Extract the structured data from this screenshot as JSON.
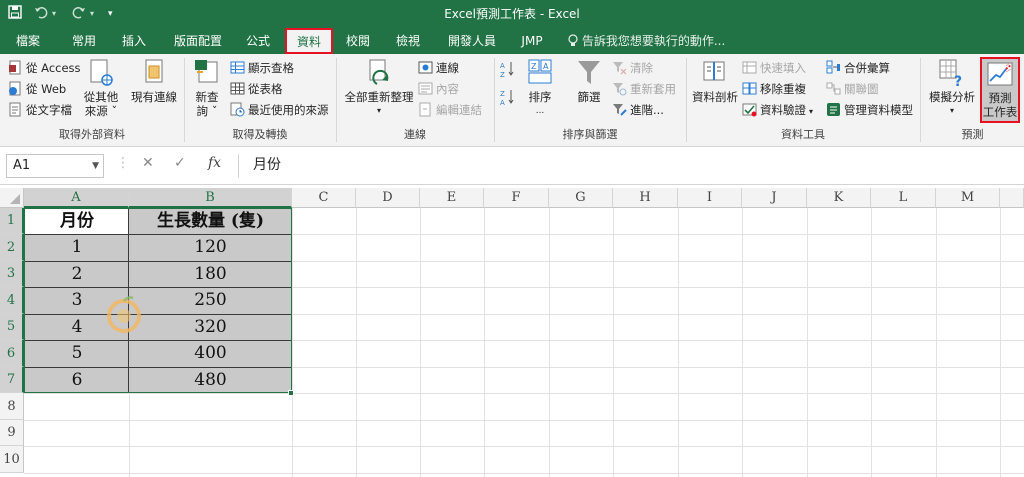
{
  "window": {
    "title": "Excel預測工作表 - Excel"
  },
  "quick_access": {
    "save_icon": "save-icon",
    "undo_icon": "undo-icon",
    "redo_icon": "redo-icon",
    "customize_icon": "customize-icon"
  },
  "tabs": [
    {
      "label": "檔案"
    },
    {
      "label": "常用"
    },
    {
      "label": "插入"
    },
    {
      "label": "版面配置"
    },
    {
      "label": "公式"
    },
    {
      "label": "資料"
    },
    {
      "label": "校閱"
    },
    {
      "label": "檢視"
    },
    {
      "label": "開發人員"
    },
    {
      "label": "JMP"
    }
  ],
  "tell_me": "告訴我您想要執行的動作...",
  "ribbon": {
    "external": {
      "access": "從 Access",
      "web": "從 Web",
      "text": "從文字檔",
      "other_line1": "從其他",
      "other_line2": "來源 ˇ",
      "existing": "現有連線",
      "label": "取得外部資料"
    },
    "transform": {
      "newquery_line1": "新查",
      "newquery_line2": "詢 ˇ",
      "show_queries": "顯示查格",
      "from_table": "從表格",
      "recent": "最近使用的來源",
      "label": "取得及轉換"
    },
    "connections": {
      "refresh": "全部重新整理",
      "connections": "連線",
      "properties": "內容",
      "edit_links": "編輯連結",
      "label": "連線"
    },
    "sort": {
      "sort": "排序",
      "filter": "篩選",
      "clear": "清除",
      "reapply": "重新套用",
      "advanced": "進階...",
      "label": "排序與篩選"
    },
    "tools": {
      "text_to_columns": "資料剖析",
      "flash_fill": "快速填入",
      "remove_dup": "移除重複",
      "validation": "資料驗證",
      "consolidate": "合併彙算",
      "relationships": "關聯圖",
      "data_model": "管理資料模型",
      "label": "資料工具"
    },
    "forecast": {
      "whatif": "模擬分析",
      "sheet_line1": "預測",
      "sheet_line2": "工作表",
      "label": "預測"
    }
  },
  "formula_bar": {
    "name_box": "A1",
    "cancel": "✕",
    "enter": "✓",
    "fx": "fx",
    "content": "月份"
  },
  "columns": [
    "A",
    "B",
    "C",
    "D",
    "E",
    "F",
    "G",
    "H",
    "I",
    "J",
    "K",
    "L",
    "M"
  ],
  "rows": [
    "1",
    "2",
    "3",
    "4",
    "5",
    "6",
    "7",
    "8",
    "9",
    "10"
  ],
  "table": {
    "headers": [
      "月份",
      "生長數量 (隻)"
    ],
    "data": [
      [
        "1",
        "120"
      ],
      [
        "2",
        "180"
      ],
      [
        "3",
        "250"
      ],
      [
        "4",
        "320"
      ],
      [
        "5",
        "400"
      ],
      [
        "6",
        "480"
      ]
    ]
  }
}
